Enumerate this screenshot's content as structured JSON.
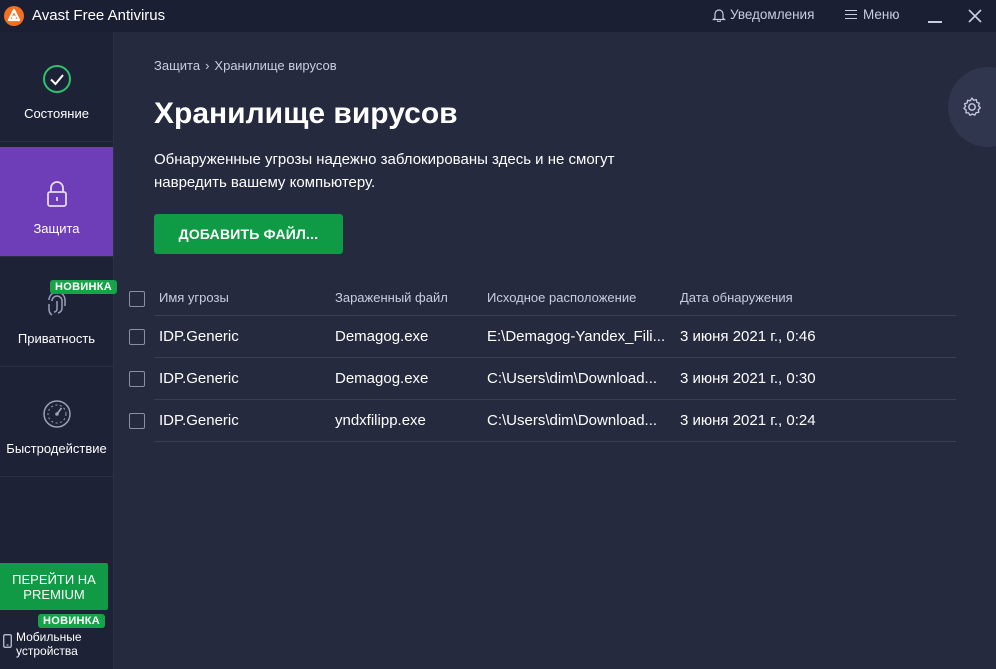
{
  "titlebar": {
    "app_title": "Avast Free Antivirus",
    "notifications_label": "Уведомления",
    "menu_label": "Меню"
  },
  "sidebar": {
    "items": [
      {
        "label": "Состояние",
        "icon": "check-circle-icon"
      },
      {
        "label": "Защита",
        "icon": "lock-icon",
        "active": true
      },
      {
        "label": "Приватность",
        "icon": "fingerprint-icon",
        "badge": "НОВИНКА"
      },
      {
        "label": "Быстродействие",
        "icon": "speedometer-icon"
      }
    ],
    "premium_label": "ПЕРЕЙТИ НА PREMIUM",
    "mobile": {
      "badge": "НОВИНКА",
      "line1": "Мобильные",
      "line2": "устройства"
    }
  },
  "main": {
    "breadcrumb": {
      "parent": "Защита",
      "separator": "›",
      "current": "Хранилище вирусов"
    },
    "title": "Хранилище вирусов",
    "description_line1": "Обнаруженные угрозы надежно заблокированы здесь и не смогут",
    "description_line2": "навредить вашему компьютеру.",
    "add_button": "ДОБАВИТЬ ФАЙЛ..."
  },
  "table": {
    "columns": [
      "Имя угрозы",
      "Зараженный файл",
      "Исходное расположение",
      "Дата обнаружения"
    ],
    "rows": [
      [
        "IDP.Generic",
        "Demagog.exe",
        "E:\\Demagog-Yandex_Fili...",
        "3 июня 2021 г., 0:46"
      ],
      [
        "IDP.Generic",
        "Demagog.exe",
        "C:\\Users\\dim\\Download...",
        "3 июня 2021 г., 0:30"
      ],
      [
        "IDP.Generic",
        "yndxfilipp.exe",
        "C:\\Users\\dim\\Download...",
        "3 июня 2021 г., 0:24"
      ]
    ]
  },
  "colors": {
    "background": "#252a3f",
    "sidebar": "#1e2237",
    "active_nav": "#6e3db8",
    "accent_green": "#0f9a46",
    "badge_green": "#17a34a",
    "logo_orange": "#f37021"
  }
}
